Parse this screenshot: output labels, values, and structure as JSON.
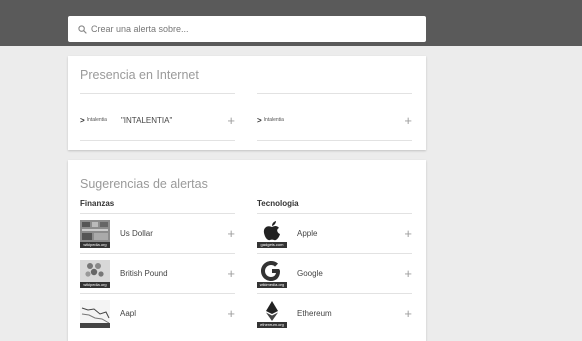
{
  "search": {
    "placeholder": "Crear una alerta sobre..."
  },
  "presence": {
    "title": "Presencia en Internet",
    "items": [
      {
        "logo_text": "Intalentia",
        "label": "\"INTALENTIA\""
      },
      {
        "logo_text": "Intalentia",
        "label": ""
      }
    ]
  },
  "suggestions": {
    "title": "Sugerencias de alertas",
    "columns": [
      {
        "heading": "Finanzas",
        "items": [
          {
            "label": "Us Dollar",
            "thumb_caption": "wikipedia.org",
            "icon": "us-dollar-thumb-icon"
          },
          {
            "label": "British Pound",
            "thumb_caption": "wikipedia.org",
            "icon": "british-pound-thumb-icon"
          },
          {
            "label": "Aapl",
            "thumb_caption": "",
            "icon": "aapl-chart-thumb-icon"
          }
        ]
      },
      {
        "heading": "Tecnologia",
        "items": [
          {
            "label": "Apple",
            "thumb_caption": "gadgets.com",
            "icon": "apple-logo-icon"
          },
          {
            "label": "Google",
            "thumb_caption": "wikimedia.org",
            "icon": "google-logo-icon"
          },
          {
            "label": "Ethereum",
            "thumb_caption": "ethereum.org",
            "icon": "ethereum-logo-icon"
          }
        ]
      }
    ]
  },
  "plus_symbol": "+",
  "colors": {
    "topbar": "#5a5a5a",
    "background": "#ececec",
    "card": "#ffffff"
  }
}
